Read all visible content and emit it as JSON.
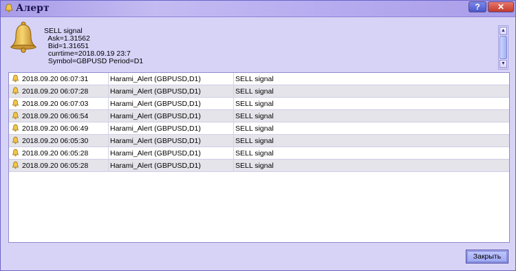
{
  "window": {
    "title": "Алерт",
    "help_label": "?",
    "close_label": "✕"
  },
  "message": {
    "lines": [
      "SELL signal",
      "  Ask=1.31562",
      "  Bid=1.31651",
      "  currtime=2018.09.19 23:7",
      "  Symbol=GBPUSD Period=D1"
    ]
  },
  "scroll": {
    "up_arrow": "▲",
    "down_arrow": "▼"
  },
  "alerts": [
    {
      "time": "2018.09.20 06:07:31",
      "name": "Harami_Alert (GBPUSD,D1)",
      "msg": "SELL signal"
    },
    {
      "time": "2018.09.20 06:07:28",
      "name": "Harami_Alert (GBPUSD,D1)",
      "msg": "SELL signal"
    },
    {
      "time": "2018.09.20 06:07:03",
      "name": "Harami_Alert (GBPUSD,D1)",
      "msg": "SELL signal"
    },
    {
      "time": "2018.09.20 06:06:54",
      "name": "Harami_Alert (GBPUSD,D1)",
      "msg": "SELL signal"
    },
    {
      "time": "2018.09.20 06:06:49",
      "name": "Harami_Alert (GBPUSD,D1)",
      "msg": "SELL signal"
    },
    {
      "time": "2018.09.20 06:05:30",
      "name": "Harami_Alert (GBPUSD,D1)",
      "msg": "SELL signal"
    },
    {
      "time": "2018.09.20 06:05:28",
      "name": "Harami_Alert (GBPUSD,D1)",
      "msg": "SELL signal"
    },
    {
      "time": "2018.09.20 06:05:28",
      "name": "Harami_Alert (GBPUSD,D1)",
      "msg": "SELL signal"
    }
  ],
  "footer": {
    "close_button": "Закрыть"
  },
  "icons": {
    "title": "bell-icon",
    "message": "bell-icon",
    "row": "bell-icon"
  },
  "colors": {
    "title_bar": "#b8adf0",
    "window_bg": "#d7d3f7",
    "row_alt": "#e4e4ea",
    "button": "#9ba5ef"
  }
}
